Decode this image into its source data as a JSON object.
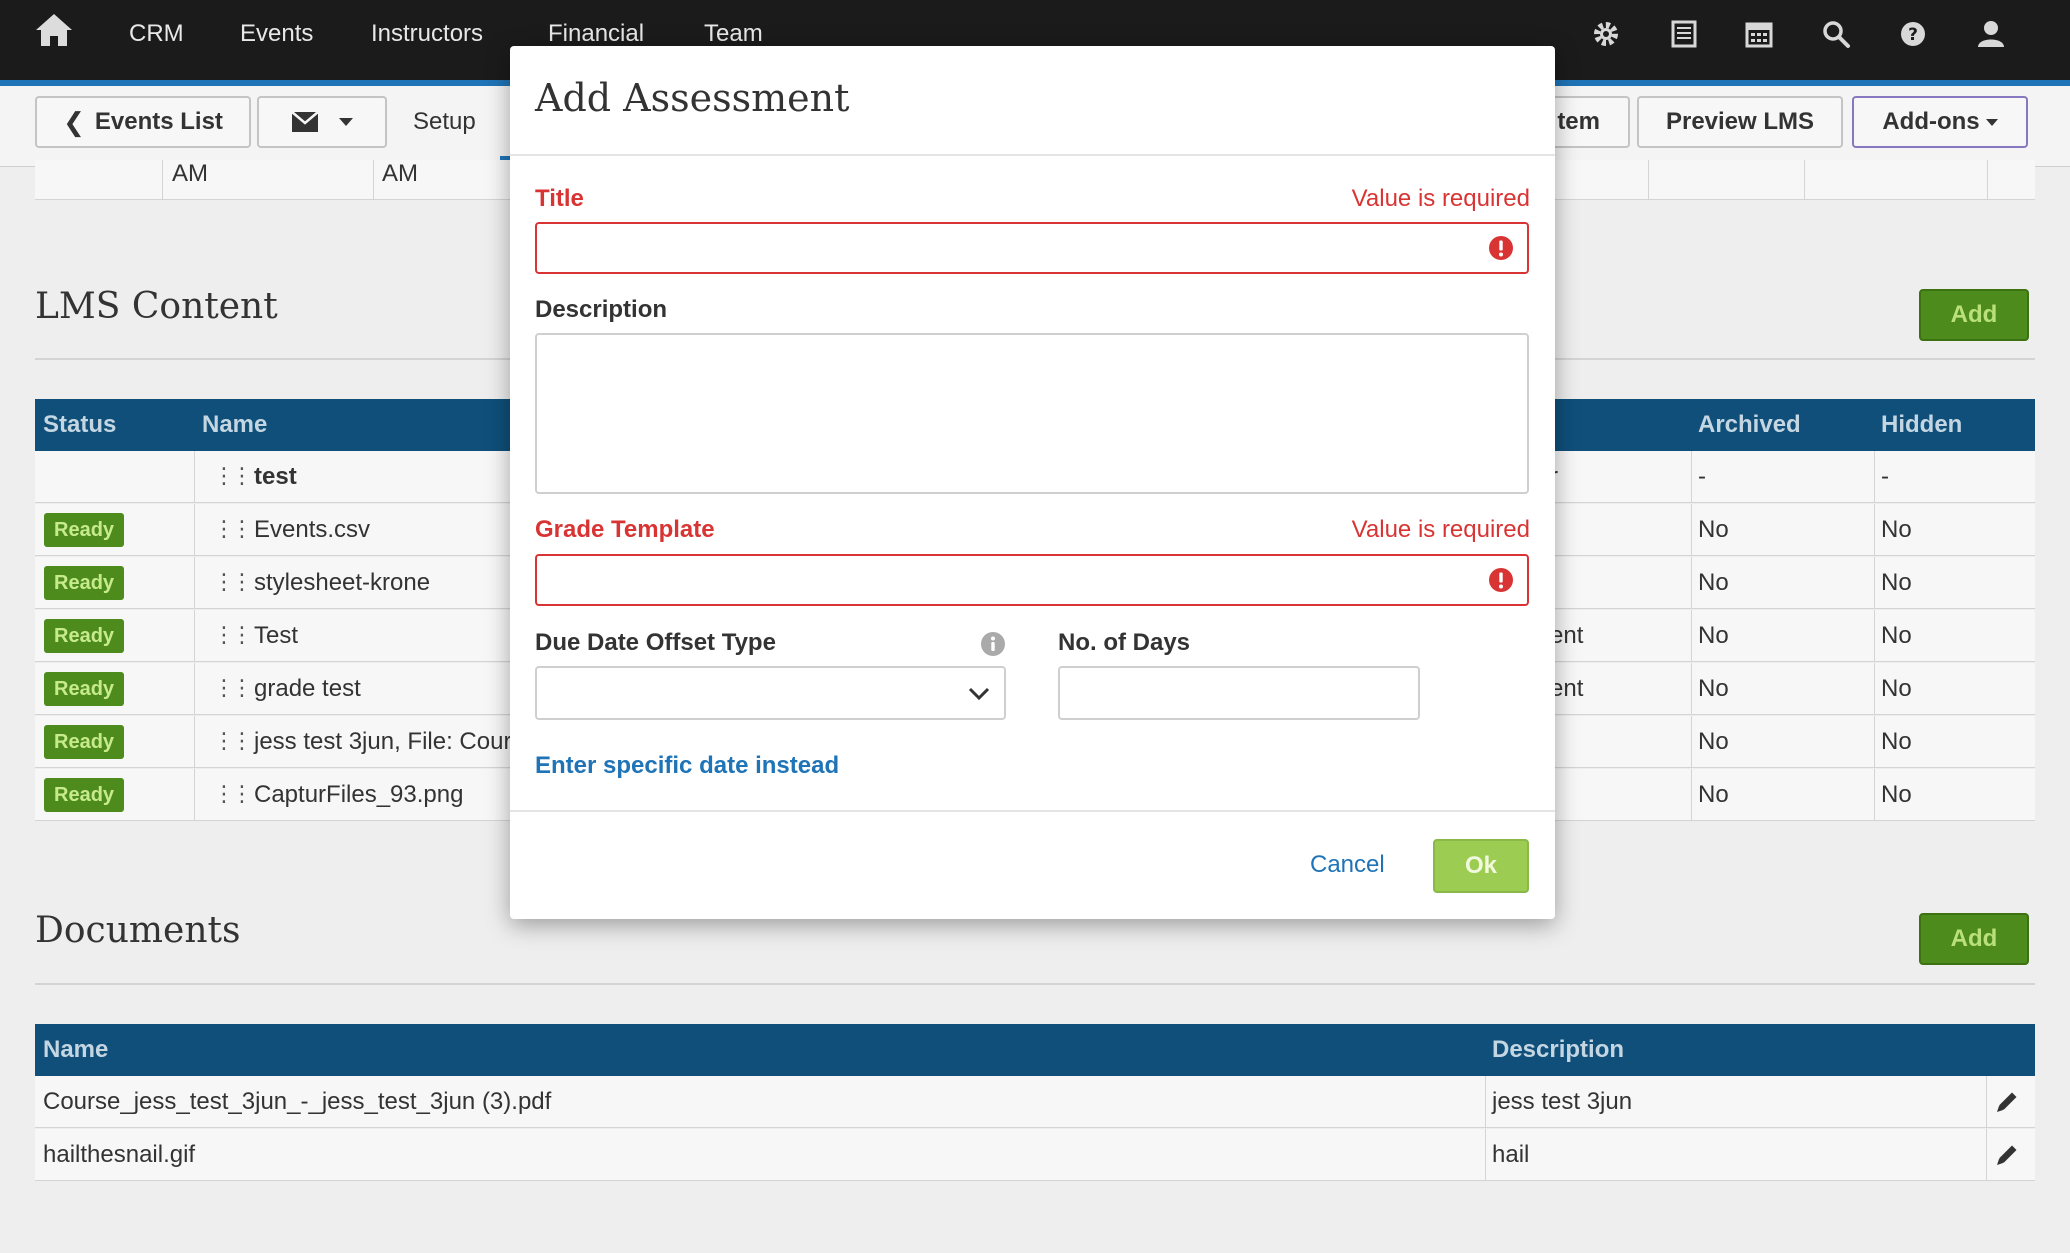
{
  "nav": {
    "items": [
      "CRM",
      "Events",
      "Instructors",
      "Financial",
      "Team"
    ],
    "icons": [
      "gear-icon",
      "list-icon",
      "calendar-icon",
      "search-icon",
      "help-icon",
      "user-icon"
    ]
  },
  "toolbar": {
    "events_list": "Events List",
    "setup": "Setup",
    "partial_tab": "tem",
    "preview_lms": "Preview LMS",
    "addons": "Add-ons"
  },
  "top_table_fragment": {
    "cells": [
      "AM",
      "AM"
    ]
  },
  "lms": {
    "title": "LMS Content",
    "add_label": "Add",
    "headers": {
      "status": "Status",
      "name": "Name",
      "archived": "Archived",
      "hidden": "Hidden"
    },
    "rows": [
      {
        "status": "",
        "name": "test",
        "bold": true,
        "partial": "r",
        "archived": "-",
        "hidden": "-"
      },
      {
        "status": "Ready",
        "name": "Events.csv",
        "partial": "",
        "archived": "No",
        "hidden": "No"
      },
      {
        "status": "Ready",
        "name": "stylesheet-krone",
        "partial": "",
        "archived": "No",
        "hidden": "No"
      },
      {
        "status": "Ready",
        "name": "Test",
        "partial": "ent",
        "archived": "No",
        "hidden": "No"
      },
      {
        "status": "Ready",
        "name": "grade test",
        "partial": "ent",
        "archived": "No",
        "hidden": "No"
      },
      {
        "status": "Ready",
        "name": "jess test 3jun, File: Cour",
        "partial": "",
        "archived": "No",
        "hidden": "No"
      },
      {
        "status": "Ready",
        "name": "CapturFiles_93.png",
        "partial": "",
        "archived": "No",
        "hidden": "No"
      }
    ]
  },
  "documents": {
    "title": "Documents",
    "add_label": "Add",
    "headers": {
      "name": "Name",
      "description": "Description"
    },
    "rows": [
      {
        "name": "Course_jess_test_3jun_-_jess_test_3jun (3).pdf",
        "description": "jess test 3jun"
      },
      {
        "name": "hailthesnail.gif",
        "description": "hail"
      }
    ]
  },
  "modal": {
    "title": "Add Assessment",
    "fields": {
      "title_label": "Title",
      "title_error": "Value is required",
      "title_value": "",
      "description_label": "Description",
      "description_value": "",
      "grade_label": "Grade Template",
      "grade_error": "Value is required",
      "grade_value": "",
      "due_offset_label": "Due Date Offset Type",
      "due_offset_value": "",
      "days_label": "No. of Days",
      "days_value": ""
    },
    "specific_date_link": "Enter specific date instead",
    "cancel_label": "Cancel",
    "ok_label": "Ok"
  },
  "colors": {
    "nav_bg": "#1b1b1b",
    "accent": "#1f74b7",
    "table_header": "#0f4f7a",
    "add_green": "#4d8b1d",
    "ok_green": "#9ccc51",
    "error_red": "#d93434"
  }
}
